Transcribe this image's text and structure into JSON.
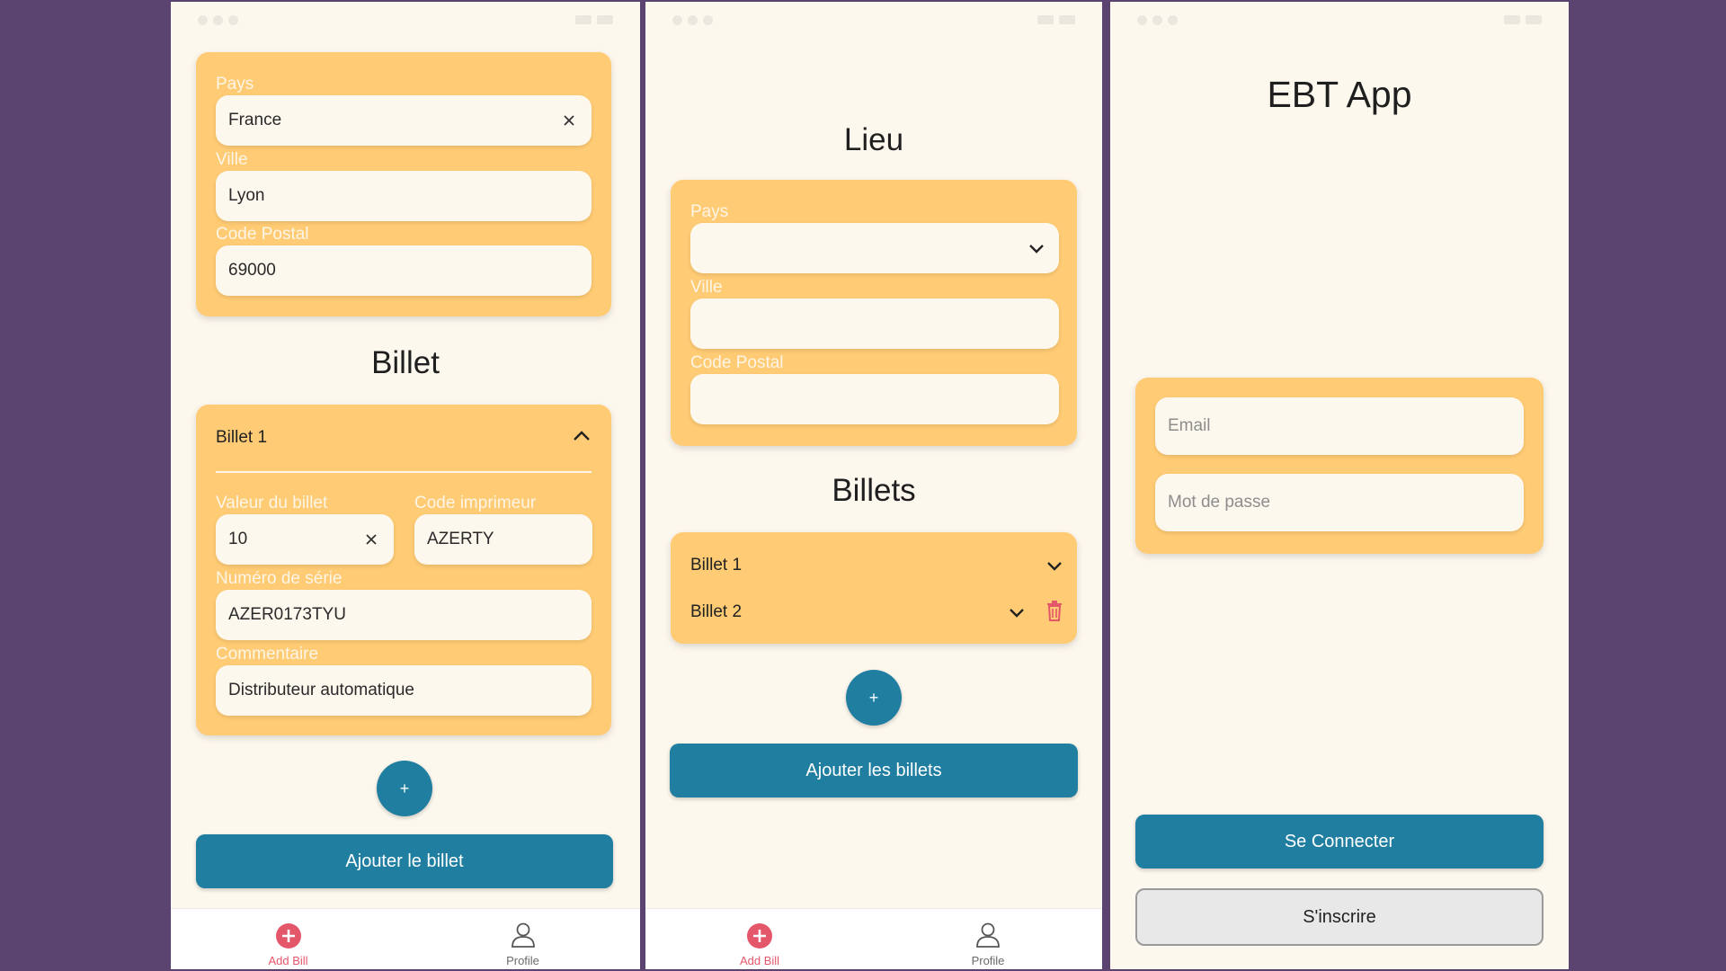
{
  "colors": {
    "background": "#5b4470",
    "screen": "#fdf8ee",
    "card": "#ffcb74",
    "primary": "#207ea0",
    "delete": "#e4566a",
    "nav_active": "#e4566a"
  },
  "screen1": {
    "location": {
      "pays_label": "Pays",
      "pays_value": "France",
      "ville_label": "Ville",
      "ville_value": "Lyon",
      "code_label": "Code Postal",
      "code_value": "69000"
    },
    "billet_title": "Billet",
    "billet": {
      "header": "Billet 1",
      "valeur_label": "Valeur du billet",
      "valeur_value": "10",
      "imprimeur_label": "Code imprimeur",
      "imprimeur_value": "AZERTY",
      "serie_label": "Numéro de série",
      "serie_value": "AZER0173TYU",
      "commentaire_label": "Commentaire",
      "commentaire_value": "Distributeur automatique"
    },
    "fab_label": "+",
    "submit_label": "Ajouter le billet",
    "nav": {
      "add_bill": "Add Bill",
      "profile": "Profile"
    }
  },
  "screen2": {
    "lieu_title": "Lieu",
    "location": {
      "pays_label": "Pays",
      "ville_label": "Ville",
      "code_label": "Code Postal"
    },
    "billets_title": "Billets",
    "billets": [
      "Billet 1",
      "Billet 2"
    ],
    "fab_label": "+",
    "submit_label": "Ajouter les billets",
    "nav": {
      "add_bill": "Add Bill",
      "profile": "Profile"
    }
  },
  "screen3": {
    "app_title": "EBT App",
    "email_placeholder": "Email",
    "password_placeholder": "Mot de passe",
    "login_label": "Se Connecter",
    "register_label": "S'inscrire"
  }
}
